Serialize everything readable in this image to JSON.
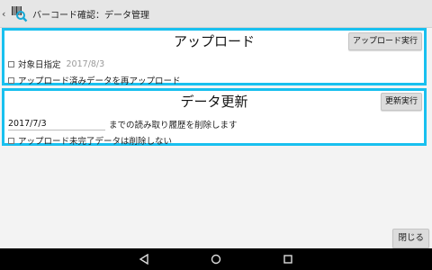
{
  "app": {
    "title": "バーコード確認：データ管理"
  },
  "upload_panel": {
    "title": "アップロード",
    "execute_label": "アップロード実行",
    "target_date_label": "対象日指定",
    "target_date_placeholder": "2017/8/3",
    "reupload_label": "アップロード済みデータを再アップロード"
  },
  "update_panel": {
    "title": "データ更新",
    "execute_label": "更新実行",
    "date_value": "2017/7/3",
    "delete_history_text": "までの読み取り履歴を削除します",
    "keep_incomplete_label": "アップロード未完了データは削除しない"
  },
  "footer": {
    "close_label": "閉じる"
  },
  "icons": {
    "back": "chevron-left-icon",
    "app": "barcode-search-icon",
    "nav_back": "triangle-back-icon",
    "nav_home": "circle-home-icon",
    "nav_recent": "square-recent-icon"
  },
  "colors": {
    "panel_border": "#19c0ef",
    "navbar": "#000000"
  }
}
